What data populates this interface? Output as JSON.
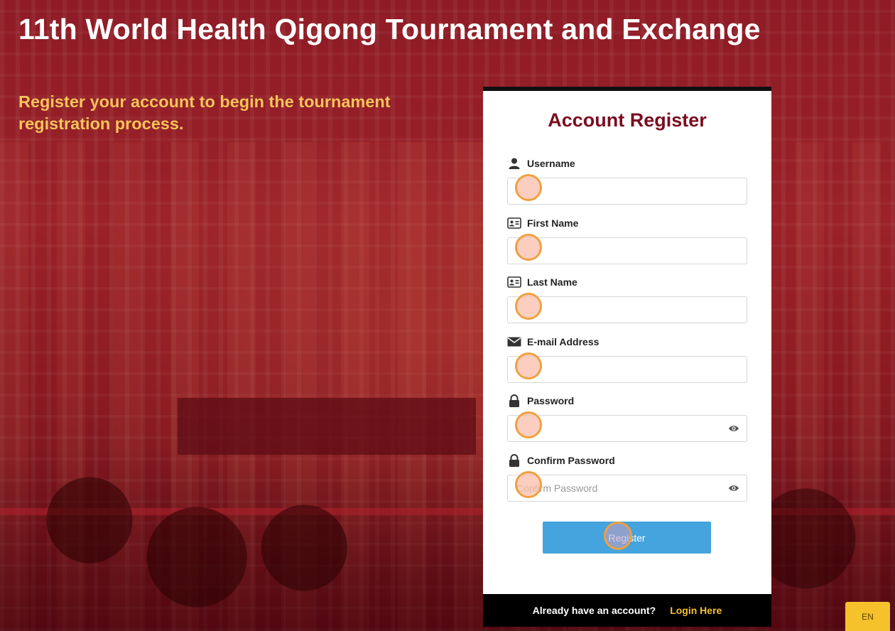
{
  "header": {
    "title": "11th World Health Qigong Tournament and Exchange",
    "subtitle": "Register your account to begin the tournament registration process."
  },
  "form": {
    "title": "Account Register",
    "fields": [
      {
        "label": "Username",
        "icon": "user-icon",
        "placeholder": "",
        "value": ""
      },
      {
        "label": "First Name",
        "icon": "id-card-icon",
        "placeholder": "",
        "value": ""
      },
      {
        "label": "Last Name",
        "icon": "id-card-icon",
        "placeholder": "",
        "value": ""
      },
      {
        "label": "E-mail Address",
        "icon": "envelope-icon",
        "placeholder": "",
        "value": ""
      },
      {
        "label": "Password",
        "icon": "lock-icon",
        "placeholder": "",
        "value": ""
      },
      {
        "label": "Confirm Password",
        "icon": "lock-icon",
        "placeholder": "Confirm Password",
        "value": ""
      }
    ],
    "submit_label": "Register"
  },
  "footer": {
    "question": "Already have an account?",
    "login_link": "Login Here"
  },
  "language": {
    "current": "EN"
  },
  "colors": {
    "title_accent": "#7a0d20",
    "subtitle": "#f7c45a",
    "button": "#45a3dd",
    "link": "#f5c22b"
  }
}
